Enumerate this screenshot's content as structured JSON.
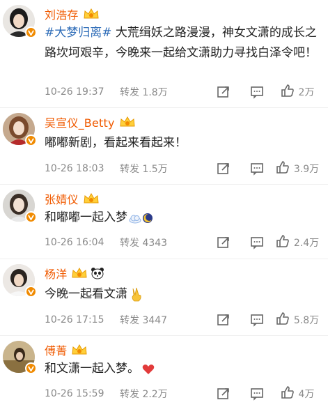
{
  "posts": [
    {
      "name": "刘浩存",
      "tag": "#大梦归离#",
      "text": "大荒缉妖之路漫漫，神女文潇的成长之路坎坷艰辛，今晚来一起给文潇助力寻找白泽令吧！",
      "time": "10-26 19:37",
      "forward_label": "转发",
      "forward_count": "1.8万",
      "like_count": "2万"
    },
    {
      "name": "吴宣仪_Betty",
      "text": "嘟嘟新剧，看起来看起来！",
      "time": "10-26 18:03",
      "forward_label": "转发",
      "forward_count": "1.5万",
      "like_count": "3.9万"
    },
    {
      "name": "张婧仪",
      "text": "和嘟嘟一起入梦",
      "time": "10-26 16:04",
      "forward_label": "转发",
      "forward_count": "4343",
      "like_count": "2.4万"
    },
    {
      "name": "杨洋",
      "text": "今晚一起看文潇",
      "time": "10-26 17:15",
      "forward_label": "转发",
      "forward_count": "3447",
      "like_count": "5.8万"
    },
    {
      "name": "傅菁",
      "text": "和文潇一起入梦。",
      "time": "10-26 15:59",
      "forward_label": "转发",
      "forward_count": "2.2万",
      "like_count": "4万"
    }
  ],
  "icons": {
    "verified": "verified-v-badge-icon",
    "crown": "crown-membership-icon",
    "repost": "repost-icon",
    "comment": "comment-icon",
    "like": "like-thumb-icon"
  },
  "colors": {
    "name": "#f05a00",
    "tag": "#2f6db8",
    "meta": "#8a8a8a",
    "verified": "#f08a00"
  }
}
